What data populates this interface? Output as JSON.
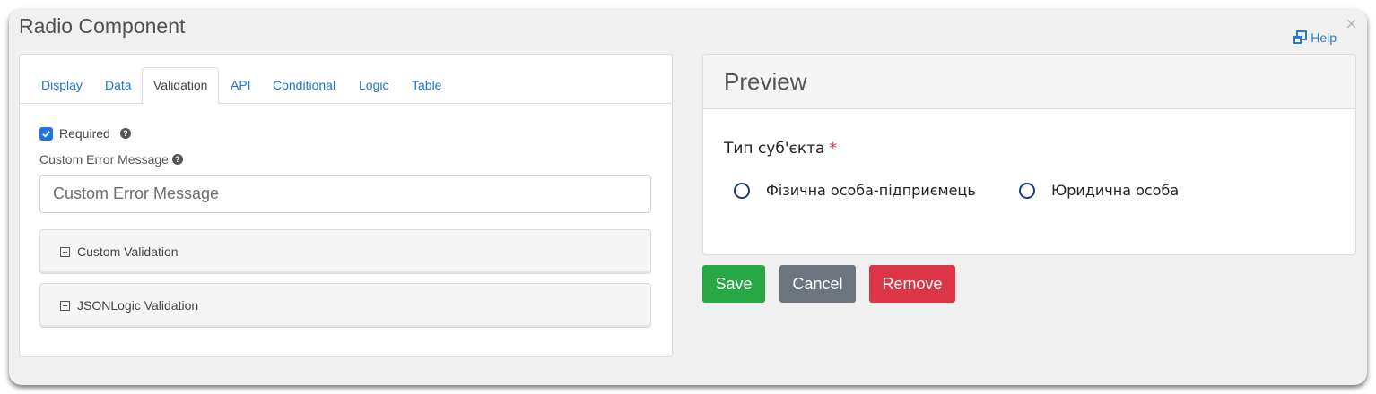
{
  "modal": {
    "title": "Radio Component",
    "close_symbol": "×",
    "help_label": "Help",
    "help_icon": "new-window-icon"
  },
  "tabs": [
    {
      "label": "Display",
      "active": false
    },
    {
      "label": "Data",
      "active": false
    },
    {
      "label": "Validation",
      "active": true
    },
    {
      "label": "API",
      "active": false
    },
    {
      "label": "Conditional",
      "active": false
    },
    {
      "label": "Logic",
      "active": false
    },
    {
      "label": "Table",
      "active": false
    }
  ],
  "validation": {
    "required_label": "Required",
    "required_checked": true,
    "custom_error_label": "Custom Error Message",
    "custom_error_placeholder": "Custom Error Message",
    "custom_error_value": "",
    "accordions": [
      {
        "label": "Custom Validation",
        "expanded": false
      },
      {
        "label": "JSONLogic Validation",
        "expanded": false
      }
    ]
  },
  "preview": {
    "title": "Preview",
    "field_label": "Тип суб'єкта",
    "required_marker": "*",
    "options": [
      {
        "label": "Фізична особа-підприємець",
        "selected": false
      },
      {
        "label": "Юридична особа",
        "selected": false
      }
    ]
  },
  "buttons": {
    "save": "Save",
    "cancel": "Cancel",
    "remove": "Remove"
  },
  "colors": {
    "link": "#1a74d8",
    "save": "#28a745",
    "cancel": "#6c757d",
    "remove": "#dc3545",
    "checkbox": "#1f73e6",
    "required_star": "#d9303a"
  }
}
